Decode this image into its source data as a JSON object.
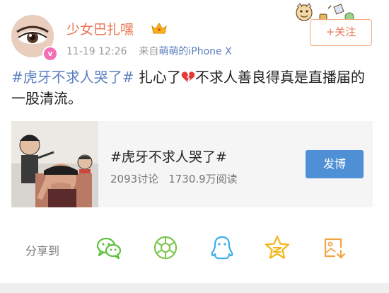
{
  "header": {
    "username": "少女巴扎嘿",
    "timestamp": "11-19 12:26",
    "source_prefix": "来自",
    "source_name": "萌萌的iPhone X",
    "vip_badge": "v",
    "follow_label": "+关注"
  },
  "post": {
    "hashtag": "#虎牙不求人哭了#",
    "text_before_icon": " 扎心了",
    "text_after_icon": "不求人善良得真是直播届的一股清流。"
  },
  "topic_card": {
    "title": "#虎牙不求人哭了#",
    "discussions": "2093讨论",
    "reads": "1730.9万阅读",
    "post_button": "发博"
  },
  "share": {
    "label": "分享到",
    "targets": [
      "wechat-icon",
      "moments-icon",
      "qq-icon",
      "qzone-icon",
      "save-image-icon"
    ]
  },
  "colors": {
    "username": "#eb7350",
    "link": "#5a7fc0",
    "accent_button": "#4f8fd6",
    "card_bg": "#f5f5f5",
    "share_wechat": "#5ac23b",
    "share_moments": "#7ac64a",
    "share_qq": "#3aaee8",
    "share_qzone": "#f3b617",
    "share_save": "#f0a442"
  }
}
